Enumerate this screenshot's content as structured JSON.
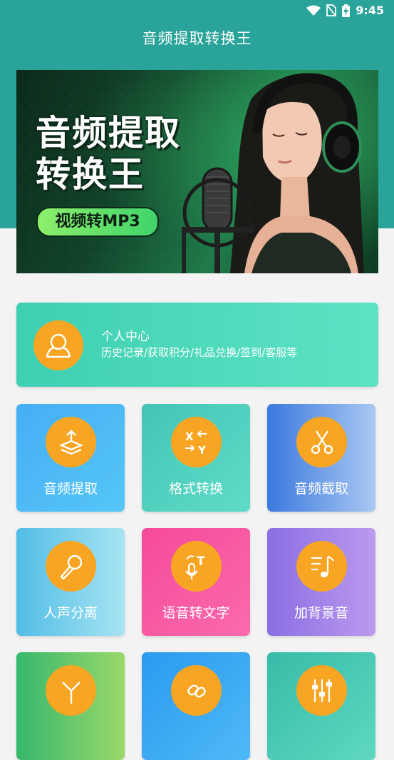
{
  "status_bar": {
    "time": "9:45",
    "icons": [
      "wifi-icon",
      "no-sim-icon",
      "battery-charging-icon"
    ]
  },
  "app": {
    "title": "音频提取转换王"
  },
  "banner": {
    "title_line1": "音频提取",
    "title_line2": "转换王",
    "pill": "视频转MP3"
  },
  "profile": {
    "title": "个人中心",
    "subtitle": "历史记录/获取积分/礼品兑换/签到/客服等",
    "icon": "user-icon"
  },
  "tools": [
    {
      "label": "音频提取",
      "icon": "extract-layers-icon"
    },
    {
      "label": "格式转换",
      "icon": "swap-xy-icon"
    },
    {
      "label": "音频截取",
      "icon": "scissors-icon"
    },
    {
      "label": "人声分离",
      "icon": "microphone-icon"
    },
    {
      "label": "语音转文字",
      "icon": "speech-to-text-icon"
    },
    {
      "label": "加背景音",
      "icon": "music-note-icon"
    },
    {
      "label": "",
      "icon": "merge-icon"
    },
    {
      "label": "",
      "icon": "link-icon"
    },
    {
      "label": "",
      "icon": "equalizer-icon"
    }
  ],
  "colors": {
    "header": "#2aa39a",
    "icon_circle": "#f7a523",
    "background": "#f3f3f3"
  }
}
